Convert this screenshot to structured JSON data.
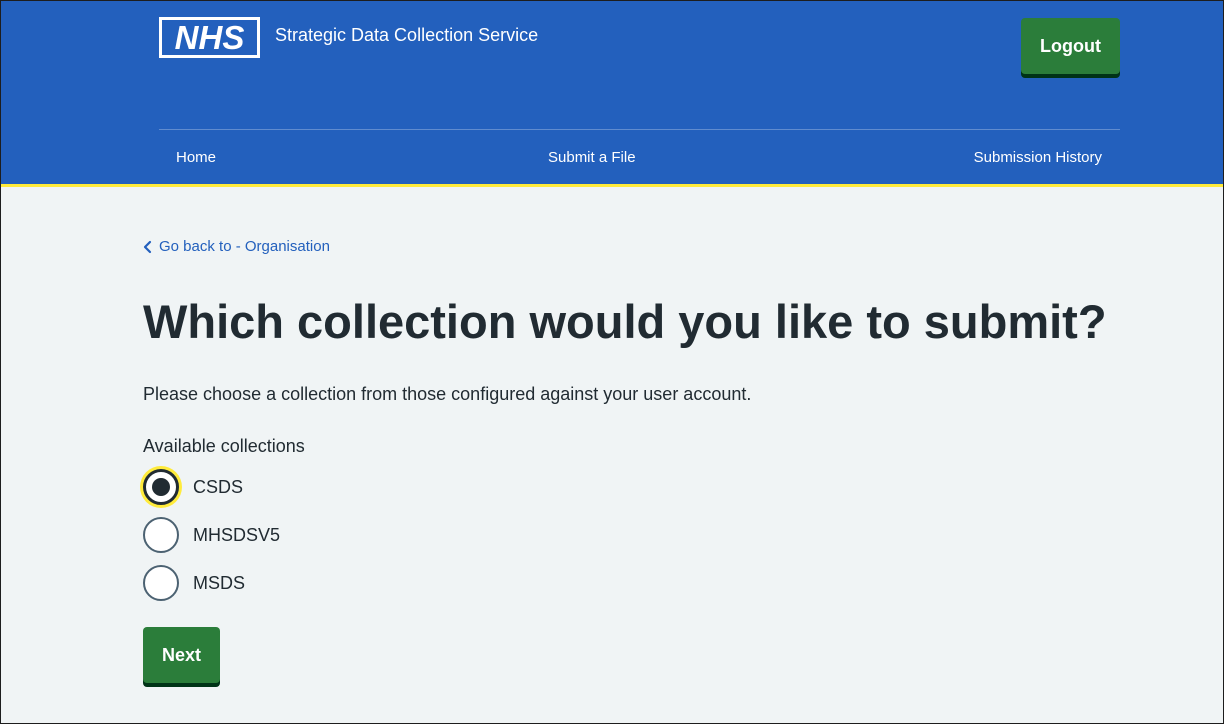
{
  "header": {
    "logo_text": "NHS",
    "service_name": "Strategic Data Collection Service",
    "logout_label": "Logout",
    "brand_color": "#2360bd",
    "button_color": "#2b7d3a"
  },
  "nav": {
    "items": [
      {
        "label": "Home"
      },
      {
        "label": "Submit a File"
      },
      {
        "label": "Submission History"
      }
    ]
  },
  "main": {
    "back_link": "Go back to - Organisation",
    "title": "Which collection would you like to submit?",
    "intro": "Please choose a collection from those configured against your user account.",
    "legend": "Available collections",
    "options": [
      {
        "label": "CSDS",
        "checked": true
      },
      {
        "label": "MHSDSV5",
        "checked": false
      },
      {
        "label": "MSDS",
        "checked": false
      }
    ],
    "next_label": "Next"
  },
  "icons": {
    "back": "chevron-left-icon",
    "logo": "nhs-logo"
  }
}
